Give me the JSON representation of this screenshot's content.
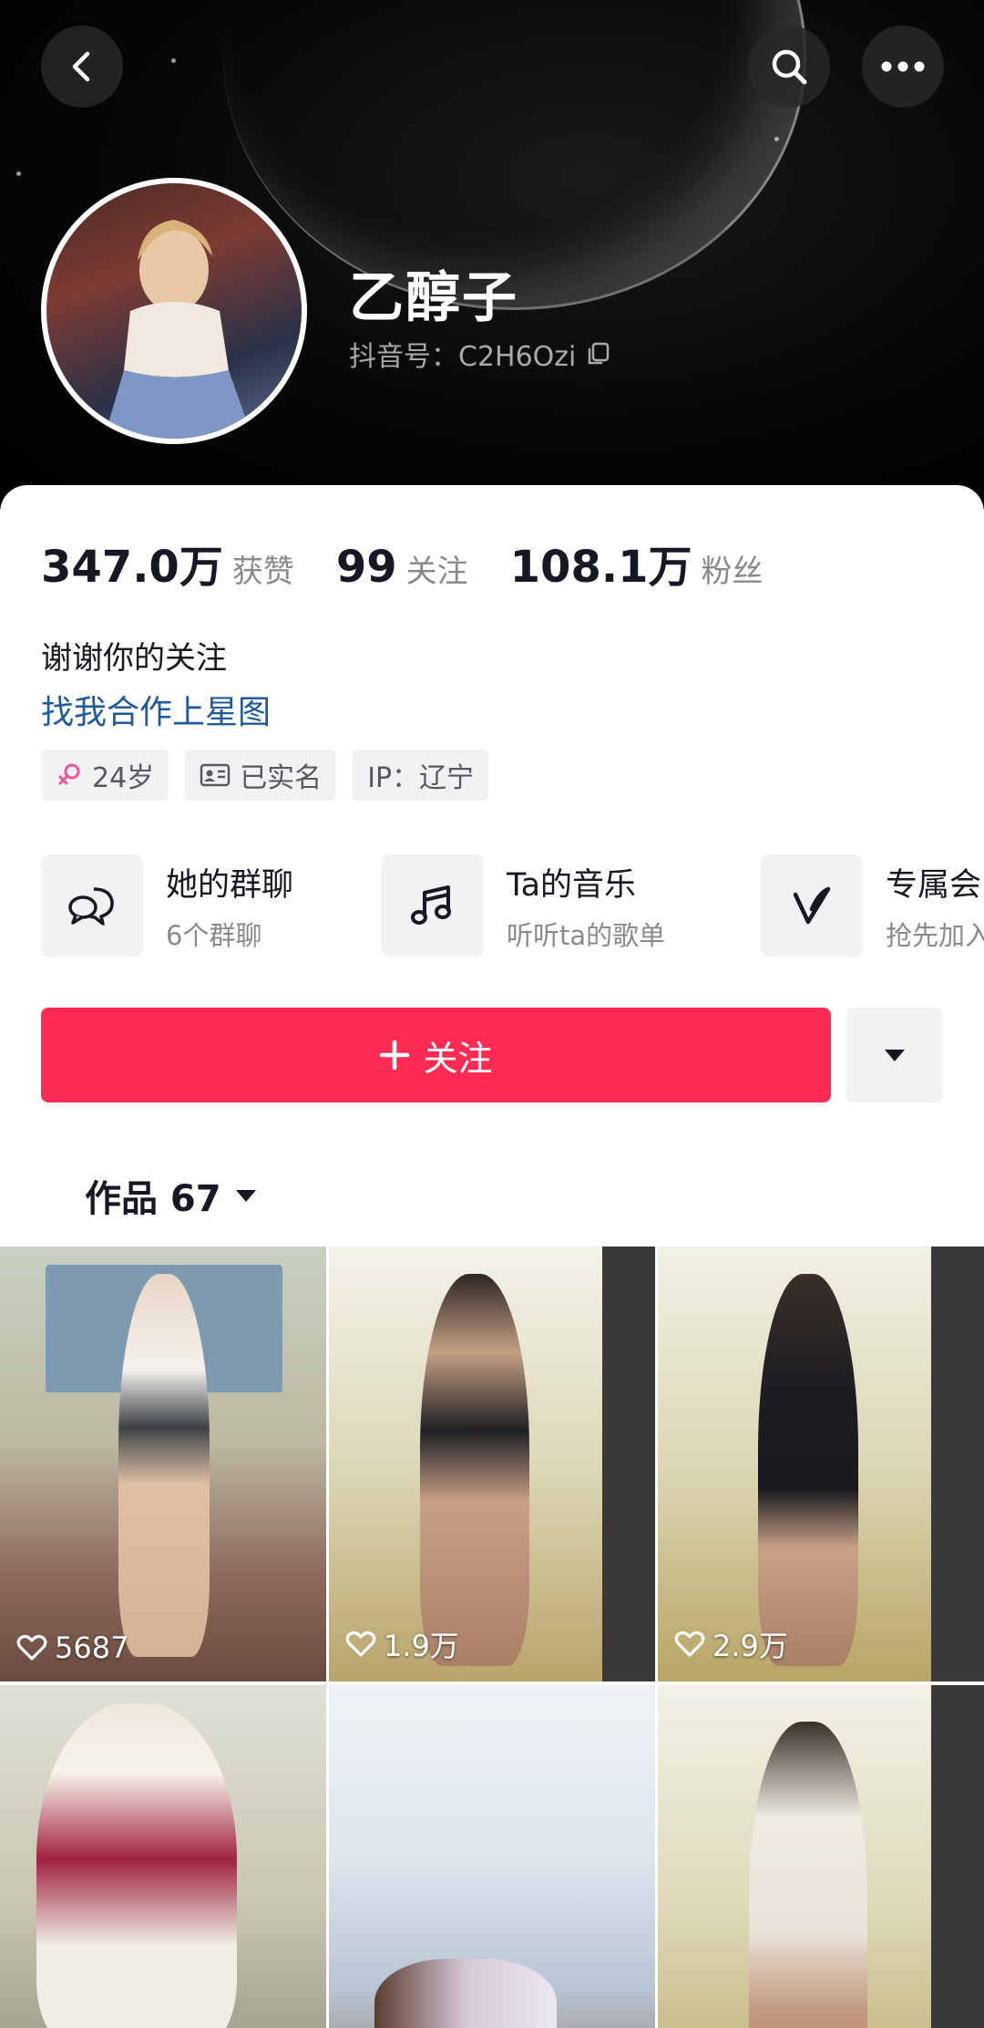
{
  "header": {
    "back_icon": "chevron-left-icon",
    "search_icon": "search-icon",
    "more_icon": "more-horizontal-icon"
  },
  "profile": {
    "name": "乙醇子",
    "handle": "抖音号：C2H6Ozi",
    "copy_icon": "copy-icon"
  },
  "stats": [
    {
      "value": "347.0万",
      "label": "获赞"
    },
    {
      "value": "99",
      "label": "关注"
    },
    {
      "value": "108.1万",
      "label": "粉丝"
    }
  ],
  "bio": {
    "text": "谢谢你的关注",
    "link": "找我合作上星图"
  },
  "tags": [
    {
      "icon": "female-icon",
      "label": "24岁"
    },
    {
      "icon": "id-card-icon",
      "label": "已实名"
    },
    {
      "icon": "",
      "label": "IP：辽宁"
    }
  ],
  "features": [
    {
      "icon": "group-chat-icon",
      "title": "她的群聊",
      "subtitle": "6个群聊"
    },
    {
      "icon": "music-note-icon",
      "title": "Ta的音乐",
      "subtitle": "听听ta的歌单"
    },
    {
      "icon": "v-badge-icon",
      "title": "专属会",
      "subtitle": "抢先加入"
    }
  ],
  "actions": {
    "follow_label": "关注",
    "colors": {
      "follow": "#fe2c55"
    }
  },
  "tabs": {
    "works_label": "作品 67"
  },
  "videos": [
    {
      "likes": "5687"
    },
    {
      "likes": "1.9万"
    },
    {
      "likes": "2.9万"
    },
    {
      "likes": ""
    },
    {
      "likes": ""
    },
    {
      "likes": ""
    }
  ]
}
